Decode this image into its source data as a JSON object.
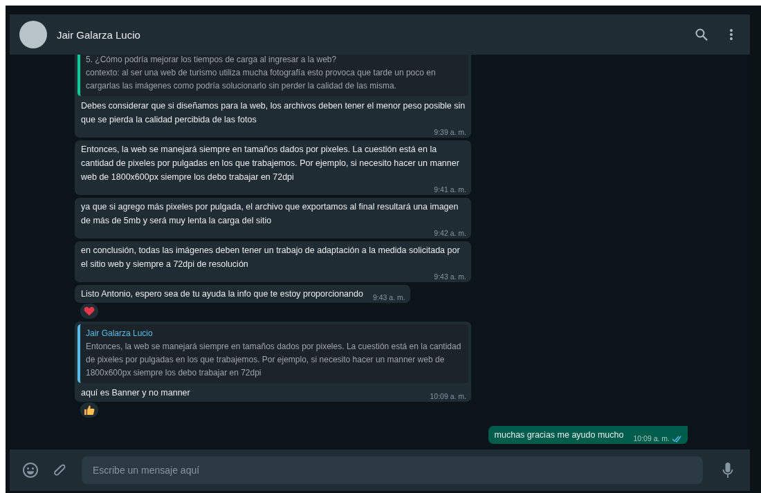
{
  "header": {
    "contact_name": "Jair Galarza Lucio"
  },
  "messages": [
    {
      "kind": "incoming",
      "quote": {
        "color": "#06cf9c",
        "text": "5. ¿Cómo podría mejorar los tiempos de carga al ingresar a la web?\ncontexto: al ser una web de turismo utiliza mucha fotografía esto provoca que tarde un poco en cargarlas las imágenes como podría solucionarlo sin perder la calidad de las misma."
      },
      "text": "Debes considerar que si diseñamos para la web, los archivos deben tener el menor peso posible sin que se pierda la calidad percibida de las fotos",
      "time": "9:39 a. m."
    },
    {
      "kind": "incoming",
      "text": "Entonces, la web se manejará siempre en tamaños dados por pixeles. La cuestión está en la cantidad de pixeles por pulgadas en los que trabajemos. Por ejemplo, si necesito hacer un manner web de 1800x600px siempre los debo trabajar en 72dpi",
      "time": "9:41 a. m."
    },
    {
      "kind": "incoming",
      "text": "ya que si agrego más pixeles por pulgada, el archivo que exportamos al final resultará una imagen de más de 5mb y será muy lenta la carga del sitio",
      "time": "9:42 a. m."
    },
    {
      "kind": "incoming",
      "text": "en conclusión, todas las imágenes deben tener un trabajo de adaptación a la medida solicitada por el sitio web y siempre a 72dpi de resolución",
      "time": "9:43 a. m."
    },
    {
      "kind": "incoming",
      "text": "Listo Antonio, espero sea de tu ayuda la info que te estoy proporcionando",
      "time": "9:43 a. m.",
      "reaction": {
        "kind": "heart"
      }
    },
    {
      "kind": "incoming",
      "quote": {
        "author": "Jair Galarza Lucio",
        "color": "#53bdeb",
        "text": "Entonces, la web se manejará siempre en tamaños dados por pixeles. La cuestión está en la cantidad de pixeles por pulgadas en los que trabajemos. Por ejemplo, si necesito hacer un manner web de 1800x600px siempre los debo trabajar en 72dpi"
      },
      "text": "aquí es Banner y no manner",
      "time": "10:09 a. m.",
      "reaction": {
        "kind": "thumbs-up"
      }
    },
    {
      "kind": "outgoing",
      "text": "muchas gracias me ayudo mucho",
      "time": "10:09 a. m.",
      "read": true
    }
  ],
  "composer": {
    "placeholder": "Escribe un mensaje aquí"
  }
}
